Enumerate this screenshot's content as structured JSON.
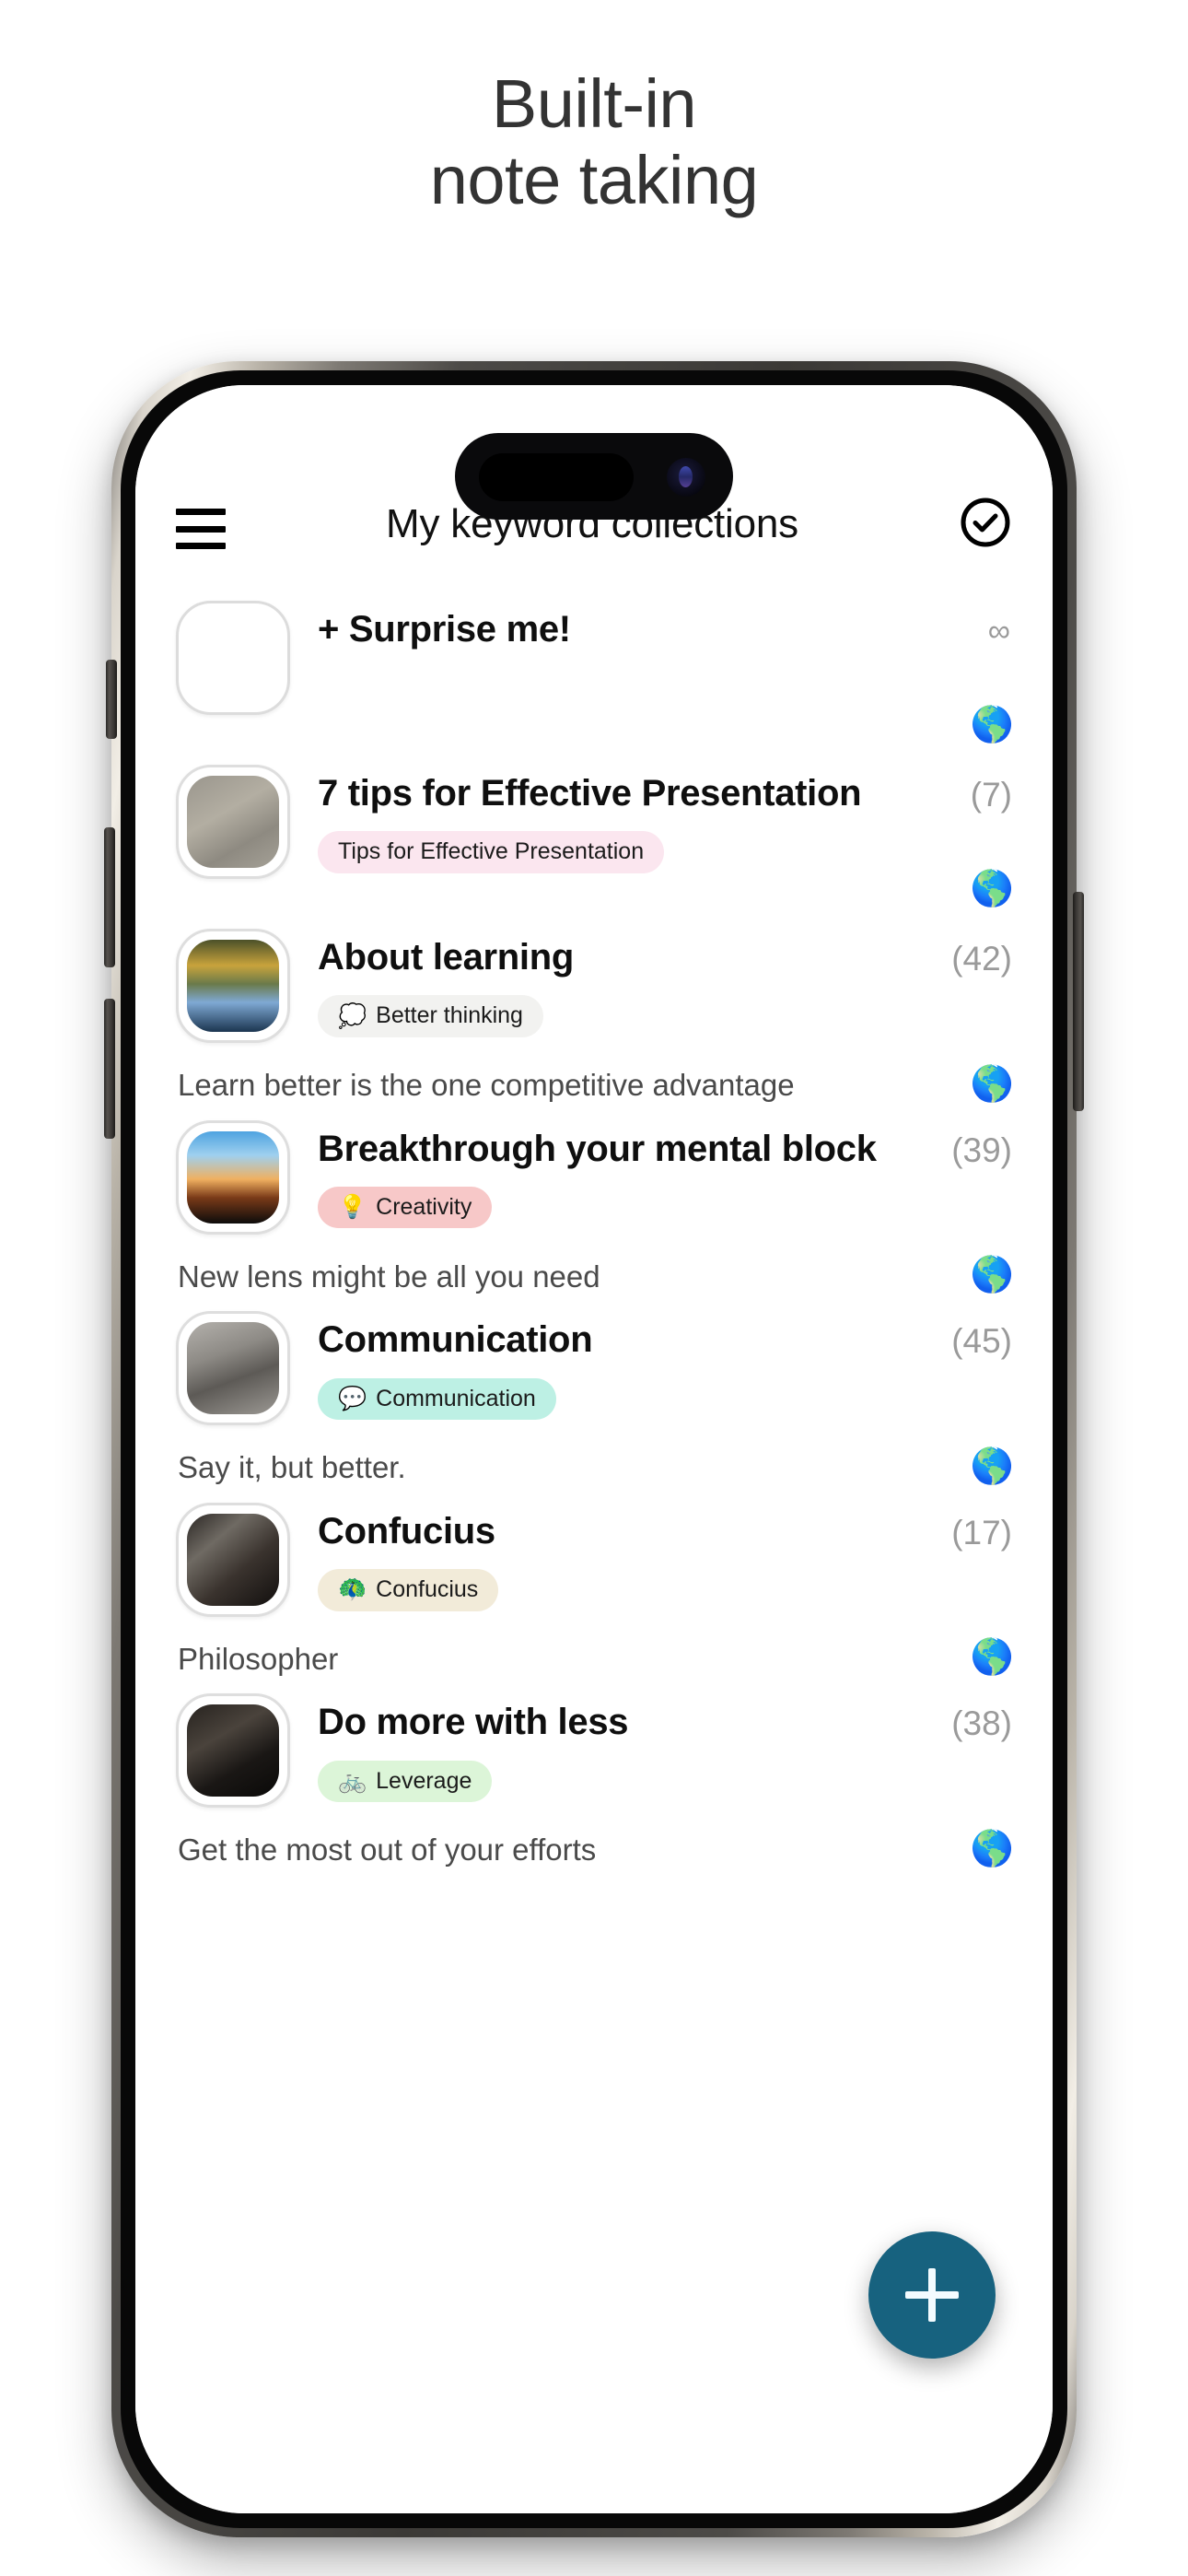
{
  "promo": {
    "line1": "Built-in",
    "line2": "note taking"
  },
  "appbar": {
    "menu_icon": "hamburger-menu-icon",
    "title": "My keyword collections",
    "confirm_icon": "check-circle-icon"
  },
  "colors": {
    "fab_background": "#17627f",
    "fab_plus": "#f3fbff",
    "tag_pink_light": "#fbe6ef",
    "tag_grey": "#f2f2f0",
    "tag_pink": "#f7c8c8",
    "tag_mint": "#bdf0e4",
    "tag_cream": "#f2ebd9",
    "tag_green": "#dcf5d8",
    "count_text": "#9a9a9a",
    "subtitle_text": "#4a4a4a",
    "title_text": "#0f0f0f",
    "headline_text": "#333333"
  },
  "list": {
    "items": [
      {
        "title": "+ Surprise me!",
        "count": "∞",
        "tag": null,
        "tag_emoji": null,
        "tag_color": null,
        "subtitle": null,
        "globe_icon": "globe-icon",
        "thumb": "empty-thumbnail",
        "thumb_color": "transparent"
      },
      {
        "title": "7 tips for Effective Presentation",
        "count": "(7)",
        "tag": "Tips for Effective Presentation",
        "tag_emoji": "",
        "tag_color": "#fbe6ef",
        "subtitle": null,
        "globe_icon": "globe-icon",
        "thumb": "compass-on-sand-thumbnail",
        "thumb_color": "linear-gradient(150deg,#9a968d 0%,#b3aea2 40%,#8e8a81 70%,#a5a197 100%)"
      },
      {
        "title": "About learning",
        "count": "(42)",
        "tag": "Better thinking",
        "tag_emoji": "💭",
        "tag_color": "#f2f2f0",
        "subtitle": "Learn better is the one competitive advantage",
        "globe_icon": "globe-icon",
        "thumb": "open-book-thumbnail",
        "thumb_color": "linear-gradient(180deg,#4b5129 0%,#c8a33c 28%,#6a7a4a 48%,#7fa9d4 68%,#1b3550 100%)"
      },
      {
        "title": "Breakthrough your mental block",
        "count": "(39)",
        "tag": "Creativity",
        "tag_emoji": "💡",
        "tag_color": "#f7c8c8",
        "subtitle": "New lens might be all you need",
        "globe_icon": "globe-icon",
        "thumb": "lightbulb-sunset-thumbnail",
        "thumb_color": "linear-gradient(180deg,#4ea3e0 0%,#9fd0ef 26%,#f0b060 52%,#7a3a18 72%,#0d0c0b 100%)"
      },
      {
        "title": "Communication",
        "count": "(45)",
        "tag": "Communication",
        "tag_emoji": "💬",
        "tag_color": "#bdf0e4",
        "subtitle": "Say it, but better.",
        "globe_icon": "globe-icon",
        "thumb": "telephone-booths-thumbnail",
        "thumb_color": "linear-gradient(160deg,#b4b1ac 0%,#8d8a85 35%,#5d5a56 60%,#9b9893 100%)"
      },
      {
        "title": "Confucius",
        "count": "(17)",
        "tag": "Confucius",
        "tag_emoji": "🦚",
        "tag_color": "#f2ebd9",
        "subtitle": "Philosopher",
        "globe_icon": "globe-icon",
        "thumb": "confucius-statue-thumbnail",
        "thumb_color": "linear-gradient(140deg,#2b2724 0%,#6f6a63 30%,#3a332e 60%,#120f0e 100%)"
      },
      {
        "title": "Do more with less",
        "count": "(38)",
        "tag": "Leverage",
        "tag_emoji": "🚲",
        "tag_color": "#dcf5d8",
        "subtitle": "Get the most out of your efforts",
        "globe_icon": "globe-icon",
        "thumb": "dark-portrait-thumbnail",
        "thumb_color": "linear-gradient(150deg,#27231f 0%,#4a433c 35%,#1a1715 65%,#0a0908 100%)"
      }
    ]
  },
  "fab": {
    "icon": "plus-icon",
    "label": "+"
  },
  "device": {
    "dynamic_island": "dynamic-island",
    "buttons": [
      "action-button",
      "volume-up-button",
      "volume-down-button",
      "power-button"
    ]
  }
}
